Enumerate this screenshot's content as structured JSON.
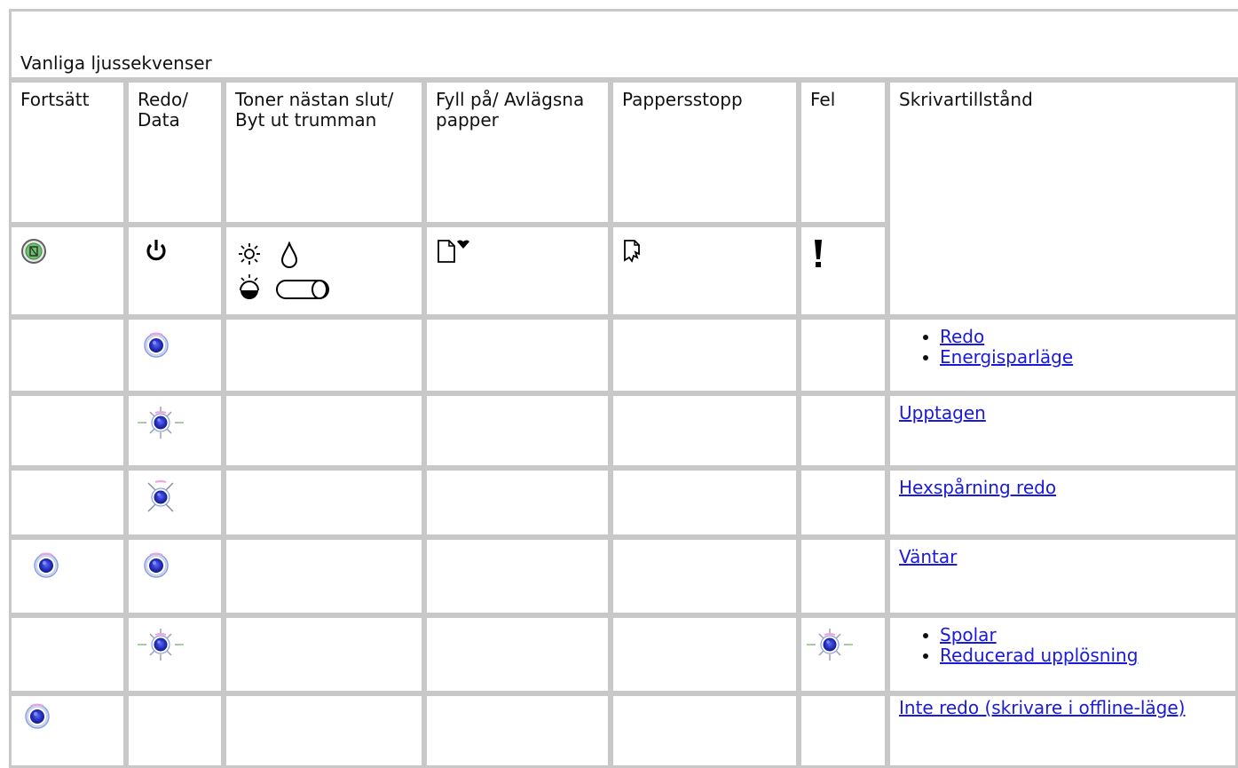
{
  "caption": "Vanliga ljussekvenser",
  "headers": {
    "continue": "Fortsätt",
    "ready_data": "Redo/ Data",
    "toner": "Toner nästan slut/ Byt ut trumman",
    "paper": "Fyll på/ Avlägsna papper",
    "jam": "Pappersstopp",
    "error": "Fel",
    "state": "Skrivartillstånd"
  },
  "icons": {
    "continue": "continue-button-icon",
    "ready_data": "power-icon",
    "toner": [
      "sun-icon",
      "toner-drop-icon",
      "drum-low-icon",
      "drum-cartridge-icon"
    ],
    "paper": "load-paper-icon",
    "jam": "paper-jam-icon",
    "error": "exclamation-icon"
  },
  "colors": {
    "led_on": "#2a34c8",
    "led_ring": "#8aa0e0",
    "link": "#1a1add",
    "grid": "#c8c8c8",
    "continue_button": "#6ec06e"
  },
  "rows": [
    {
      "states": [
        "Redo",
        "Energisparläge"
      ],
      "leds": {
        "continue": "off",
        "ready_data": "on",
        "error": "off"
      }
    },
    {
      "states": [
        "Upptagen"
      ],
      "leds": {
        "continue": "off",
        "ready_data": "blinking",
        "error": "off"
      }
    },
    {
      "states": [
        "Hexspårning redo"
      ],
      "leds": {
        "continue": "off",
        "ready_data": "blinking-slow",
        "error": "off"
      }
    },
    {
      "states": [
        "Väntar"
      ],
      "leds": {
        "continue": "on",
        "ready_data": "on",
        "error": "off"
      }
    },
    {
      "states": [
        "Spolar",
        "Reducerad upplösning"
      ],
      "leds": {
        "continue": "off",
        "ready_data": "blinking",
        "error": "blinking"
      }
    },
    {
      "states": [
        "Inte redo (skrivare i offline-läge)"
      ],
      "leds": {
        "continue": "on",
        "ready_data": "off",
        "error": "off"
      }
    }
  ]
}
